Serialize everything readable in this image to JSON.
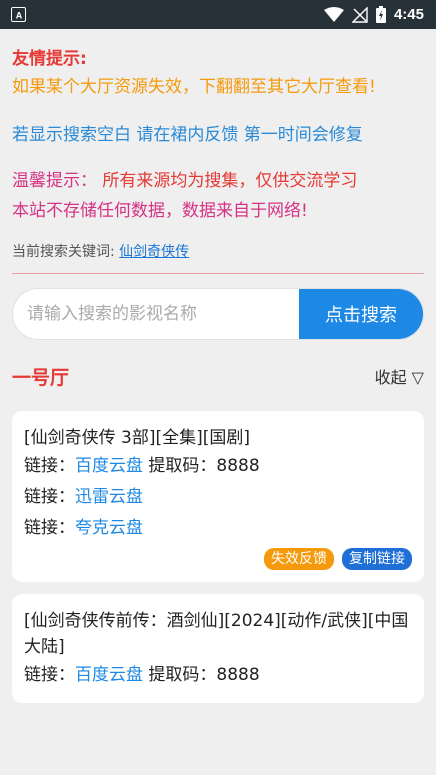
{
  "status_bar": {
    "time": "4:45",
    "app_icon_letter": "A"
  },
  "notice": {
    "title": "友情提示:",
    "orange_text": "如果某个大厅资源失效，下翻翻至其它大厅查看!",
    "blue_text": "若显示搜索空白 请在裙内反馈 第一时间会修复",
    "warm_label": "温馨提示：",
    "warm_red": "所有来源均为搜集，仅供交流学习",
    "warm_text": "本站不存储任何数据，数据来自于网络!"
  },
  "keyword": {
    "label": "当前搜索关键词: ",
    "value": "仙剑奇侠传"
  },
  "search": {
    "placeholder": "请输入搜索的影视名称",
    "button": "点击搜索"
  },
  "hall": {
    "title": "一号厅",
    "collapse_label": "收起 ▽"
  },
  "results": [
    {
      "title": "[仙剑奇侠传 3部][全集][国剧]",
      "links": [
        {
          "prefix": "链接：",
          "name": "百度云盘",
          "suffix": " 提取码：8888"
        },
        {
          "prefix": "链接：",
          "name": "迅雷云盘",
          "suffix": ""
        },
        {
          "prefix": "链接：",
          "name": "夸克云盘",
          "suffix": ""
        }
      ],
      "report_label": "失效反馈",
      "copy_label": "复制链接"
    },
    {
      "title": "[仙剑奇侠传前传：酒剑仙][2024][动作/武侠][中国大陆]",
      "links": [
        {
          "prefix": "链接：",
          "name": "百度云盘",
          "suffix": " 提取码：8888"
        }
      ]
    }
  ],
  "colors": {
    "status_bar": "#263238",
    "accent_blue": "#1e88e5",
    "red": "#e53935",
    "orange": "#f59a0c"
  }
}
